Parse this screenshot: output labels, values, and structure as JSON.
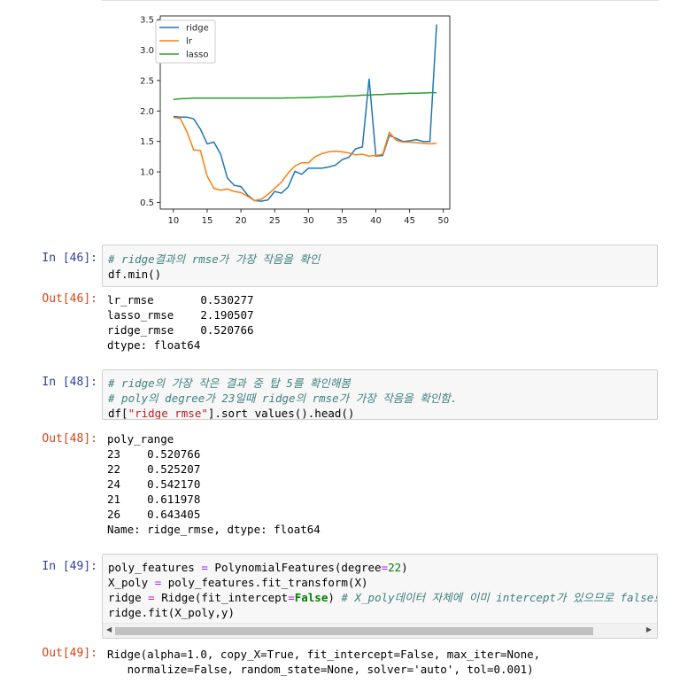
{
  "chart_data": {
    "type": "line",
    "x": [
      10,
      11,
      12,
      13,
      14,
      15,
      16,
      17,
      18,
      19,
      20,
      21,
      22,
      23,
      24,
      25,
      26,
      27,
      28,
      29,
      30,
      31,
      32,
      33,
      34,
      35,
      36,
      37,
      38,
      39,
      40,
      41,
      42,
      43,
      44,
      45,
      46,
      47,
      48,
      49
    ],
    "series": [
      {
        "name": "ridge",
        "color": "#1f77b4",
        "values": [
          1.91,
          1.9,
          1.9,
          1.87,
          1.7,
          1.46,
          1.49,
          1.29,
          0.9,
          0.78,
          0.76,
          0.62,
          0.53,
          0.52,
          0.54,
          0.68,
          0.65,
          0.75,
          1.01,
          0.96,
          1.06,
          1.06,
          1.06,
          1.08,
          1.11,
          1.2,
          1.24,
          1.38,
          1.41,
          2.53,
          1.26,
          1.27,
          1.6,
          1.55,
          1.5,
          1.51,
          1.53,
          1.5,
          1.5,
          3.42
        ]
      },
      {
        "name": "lr",
        "color": "#ff7f0e",
        "values": [
          1.89,
          1.88,
          1.66,
          1.36,
          1.35,
          0.93,
          0.73,
          0.7,
          0.72,
          0.68,
          0.66,
          0.6,
          0.53,
          0.55,
          0.63,
          0.73,
          0.83,
          0.98,
          1.1,
          1.15,
          1.15,
          1.25,
          1.3,
          1.33,
          1.34,
          1.33,
          1.31,
          1.28,
          1.29,
          1.26,
          1.27,
          1.29,
          1.65,
          1.52,
          1.49,
          1.49,
          1.48,
          1.47,
          1.46,
          1.47
        ]
      },
      {
        "name": "lasso",
        "color": "#2ca02c",
        "values": [
          2.19,
          2.2,
          2.205,
          2.21,
          2.21,
          2.21,
          2.21,
          2.21,
          2.21,
          2.21,
          2.21,
          2.21,
          2.21,
          2.21,
          2.21,
          2.21,
          2.21,
          2.215,
          2.215,
          2.22,
          2.22,
          2.225,
          2.23,
          2.23,
          2.24,
          2.24,
          2.25,
          2.25,
          2.26,
          2.26,
          2.27,
          2.27,
          2.28,
          2.28,
          2.285,
          2.29,
          2.29,
          2.295,
          2.3,
          2.3
        ]
      }
    ],
    "xticks": [
      10,
      15,
      20,
      25,
      30,
      35,
      40,
      45,
      50
    ],
    "yticks": [
      0.5,
      1.0,
      1.5,
      2.0,
      2.5,
      3.0,
      3.5
    ],
    "xlim": [
      8.05,
      50.95
    ],
    "ylim": [
      0.39,
      3.56
    ],
    "legend": "top-left",
    "title": "",
    "xlabel": "",
    "ylabel": ""
  },
  "cells": {
    "c46": {
      "in_prompt": "In [46]:",
      "out_prompt": "Out[46]:",
      "code_comment": "# ridge결과의 rmse가 가장 작음을 확인",
      "code_line2": "df.min()",
      "output": "lr_rmse       0.530277\nlasso_rmse    2.190507\nridge_rmse    0.520766\ndtype: float64"
    },
    "c48": {
      "in_prompt": "In [48]:",
      "out_prompt": "Out[48]:",
      "comment1": "# ridge의 가장 작은 결과 중 탑 5를 확인해봄",
      "comment2": "# poly의 degree가 23일때 ridge의 rmse가 가장 작음을 확인함.",
      "code_df": "df[",
      "code_str": "\"ridge_rmse\"",
      "code_rest": "].sort_values().head()",
      "output": "poly_range\n23    0.520766\n22    0.525207\n24    0.542170\n21    0.611978\n26    0.643405\nName: ridge_rmse, dtype: float64"
    },
    "c49": {
      "in_prompt": "In [49]:",
      "out_prompt": "Out[49]:",
      "l1_a": "poly_features ",
      "l1_op": "=",
      "l1_b": " PolynomialFeatures(degree",
      "l1_op2": "=",
      "l1_num": "22",
      "l1_c": ")",
      "l2_a": "X_poly ",
      "l2_op": "=",
      "l2_b": " poly_features.fit_transform(X)",
      "l3_a": "ridge ",
      "l3_op": "=",
      "l3_b": " Ridge(fit_intercept",
      "l3_op2": "=",
      "l3_kw": "False",
      "l3_c": ") ",
      "l3_comment": "# X_poly데이터 자체에 이미 intercept가 있으므로 false로",
      "l4": "ridge.fit(X_poly,y)",
      "output": "Ridge(alpha=1.0, copy_X=True, fit_intercept=False, max_iter=None,\n   normalize=False, random_state=None, solver='auto', tol=0.001)"
    }
  },
  "scrollbar": {
    "left_arrow": "◀",
    "right_arrow": "▶"
  }
}
